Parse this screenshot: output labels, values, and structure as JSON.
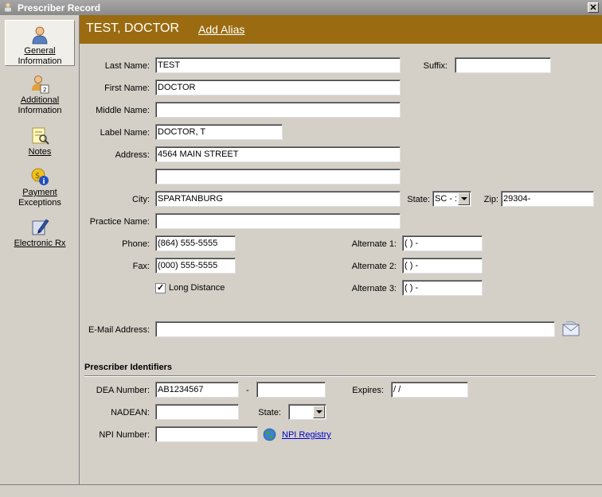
{
  "window": {
    "title": "Prescriber Record",
    "close_label": "✕"
  },
  "sidebar": {
    "items": [
      {
        "label_line1": "General",
        "label_line2": "Information",
        "icon": "person-icon"
      },
      {
        "label_line1": "Additional",
        "label_line2": "Information",
        "icon": "person-card-icon"
      },
      {
        "label_line1": "Notes",
        "label_line2": "",
        "icon": "notes-icon"
      },
      {
        "label_line1": "Payment",
        "label_line2": "Exceptions",
        "icon": "payment-icon"
      },
      {
        "label_line1": "Electronic Rx",
        "label_line2": "",
        "icon": "pencil-icon"
      }
    ]
  },
  "header": {
    "name": "TEST, DOCTOR",
    "alias_link": "Add Alias"
  },
  "form": {
    "last_name": {
      "label": "Last Name:",
      "value": "TEST"
    },
    "suffix": {
      "label": "Suffix:",
      "value": ""
    },
    "first_name": {
      "label": "First Name:",
      "value": "DOCTOR"
    },
    "middle_name": {
      "label": "Middle Name:",
      "value": ""
    },
    "label_name": {
      "label": "Label Name:",
      "value": "DOCTOR, T"
    },
    "address": {
      "label": "Address:",
      "value": "4564 MAIN STREET",
      "value2": ""
    },
    "city": {
      "label": "City:",
      "value": "SPARTANBURG"
    },
    "state": {
      "label": "State:",
      "value": "SC - :"
    },
    "zip": {
      "label": "Zip:",
      "value": "29304-"
    },
    "practice_name": {
      "label": "Practice Name:",
      "value": ""
    },
    "phone": {
      "label": "Phone:",
      "value": "(864) 555-5555"
    },
    "fax": {
      "label": "Fax:",
      "value": "(000) 555-5555"
    },
    "alternate1": {
      "label": "Alternate 1:",
      "value": "(   )     -"
    },
    "alternate2": {
      "label": "Alternate 2:",
      "value": "(   )     -"
    },
    "alternate3": {
      "label": "Alternate 3:",
      "value": "(   )     -"
    },
    "long_distance": {
      "label": "Long Distance",
      "checked": true
    },
    "email": {
      "label": "E-Mail Address:",
      "value": ""
    }
  },
  "identifiers": {
    "section_title": "Prescriber Identifiers",
    "dea": {
      "label": "DEA Number:",
      "value": "AB1234567",
      "suffix_value": "",
      "dash": "-"
    },
    "expires": {
      "label": "Expires:",
      "value": "  /  /"
    },
    "nadean": {
      "label": "NADEAN:",
      "value": ""
    },
    "state": {
      "label": "State:",
      "value": ""
    },
    "npi": {
      "label": "NPI Number:",
      "value": "",
      "registry_link": "NPI Registry"
    }
  },
  "colors": {
    "header_bg": "#9a6b10",
    "panel_bg": "#d4d0c8",
    "link": "#0000cc"
  }
}
